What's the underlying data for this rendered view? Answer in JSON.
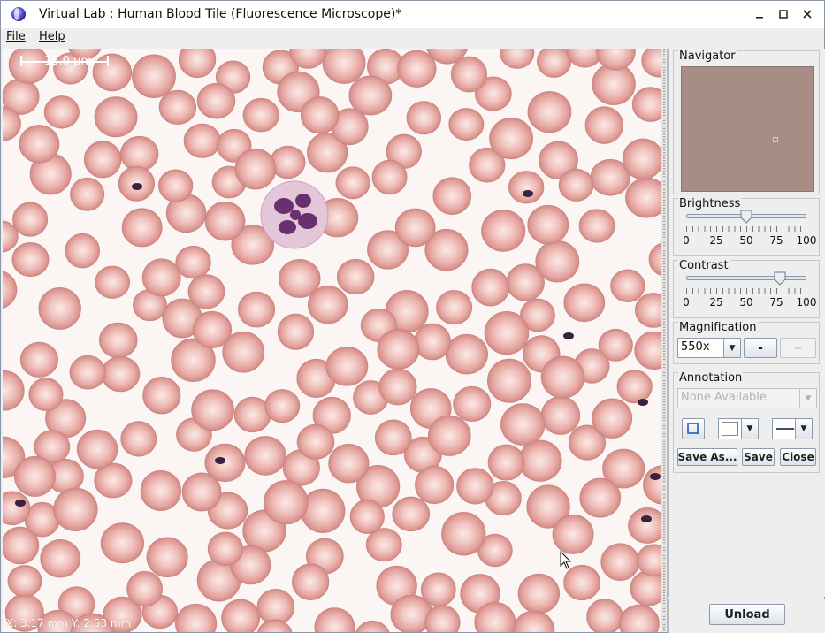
{
  "window": {
    "title": "Virtual Lab : Human Blood Tile (Fluorescence Microscope)*",
    "controls": [
      "minimize-icon",
      "maximize-icon",
      "close-icon"
    ]
  },
  "menu": {
    "file": "File",
    "help": "Help"
  },
  "viewport": {
    "scale_label": "15.0 μm",
    "coords_label": "X: 3.17 mm  Y: 2.53 mm",
    "background_color": "#fbf5f3",
    "rbc_color": "#e4a29d",
    "wbc_color": "#6a2f6f"
  },
  "navigator": {
    "title": "Navigator",
    "tile_color": "#a88c86",
    "marker_color": "#f2e600"
  },
  "brightness": {
    "title": "Brightness",
    "value": 50,
    "ticks": [
      "0",
      "25",
      "50",
      "75",
      "100"
    ]
  },
  "contrast": {
    "title": "Contrast",
    "value": 78,
    "ticks": [
      "0",
      "25",
      "50",
      "75",
      "100"
    ]
  },
  "magnification": {
    "title": "Magnification",
    "selected": "550x",
    "minus_label": "-",
    "plus_label": "+"
  },
  "annotation": {
    "title": "Annotation",
    "selected": "None Available",
    "shape_icon": "rectangle-icon",
    "color_value": "#ffffff",
    "line_style_icon": "line-style-icon",
    "save_as_label": "Save As...",
    "save_label": "Save",
    "close_label": "Close"
  },
  "footer": {
    "unload_label": "Unload"
  }
}
